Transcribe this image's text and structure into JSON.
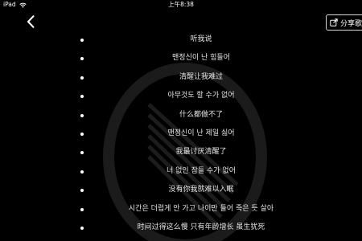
{
  "status_bar": {
    "carrier": "iPad",
    "time": "上午8:38",
    "wifi_icon": "wifi-icon"
  },
  "nav": {
    "back_icon": "chevron-left-icon",
    "share_label": "分享歌",
    "share_icon": "share-icon"
  },
  "lyrics": [
    "听我说",
    "맨정신이 난 힘들어",
    "清醒让我难过",
    "아무것도 할 수가 없어",
    "什么都做不了",
    "맨정신이 난 제일 싫어",
    "我最讨厌清醒了",
    "너 없인 잠들 수가 없어",
    "没有你我就难以入眠",
    "시간은 더럽게 안 가고 나이만 들어 죽은 듯 살아",
    "时间过得这么慢 只有年龄增长 虽生犹死"
  ],
  "colors": {
    "background": "#000000",
    "text": "#e6e6e6"
  }
}
